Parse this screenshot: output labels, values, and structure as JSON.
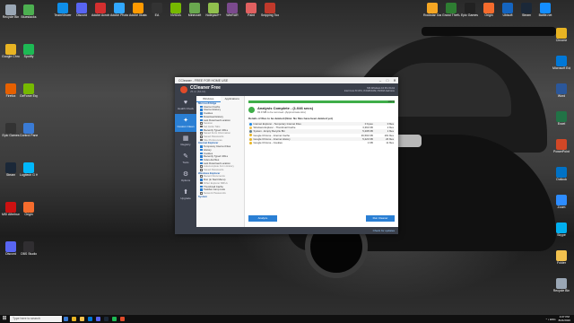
{
  "colors": {
    "accent": "#2a7fd4",
    "success": "#3fae49",
    "app_dark": "#3a3f4a"
  },
  "desktop": {
    "left_icons": [
      {
        "label": "Recycle Bin",
        "color": "#9aa7b5",
        "icon": "recycle-icon"
      },
      {
        "label": "Google Chrome",
        "color": "#e8b423",
        "icon": "chrome-icon"
      },
      {
        "label": "Firefox",
        "color": "#e66000",
        "icon": "firefox-icon"
      },
      {
        "label": "Epic Games",
        "color": "#333",
        "icon": "epic-icon"
      },
      {
        "label": "Steam",
        "color": "#1b2838",
        "icon": "steam-icon"
      },
      {
        "label": "MSI Afterburner",
        "color": "#c11",
        "icon": "afterburner-icon"
      },
      {
        "label": "Discord",
        "color": "#5865f2",
        "icon": "discord-icon"
      },
      {
        "label": "Bluestacks",
        "color": "#4caf50",
        "icon": "bluestacks-icon"
      },
      {
        "label": "Spotify",
        "color": "#1db954",
        "icon": "spotify-icon"
      },
      {
        "label": "GeForce Experience",
        "color": "#76b900",
        "icon": "geforce-icon"
      },
      {
        "label": "Control Panel",
        "color": "#3a7bd5",
        "icon": "control-panel-icon"
      },
      {
        "label": "Logitech G HUB",
        "color": "#00b8fc",
        "icon": "ghub-icon"
      },
      {
        "label": "Origin",
        "color": "#f56c2d",
        "icon": "origin-icon"
      },
      {
        "label": "OBS Studio",
        "color": "#302e31",
        "icon": "obs-icon"
      }
    ],
    "top_icons": [
      {
        "label": "TeamViewer",
        "color": "#0e8ee9",
        "icon": "teamviewer-icon"
      },
      {
        "label": "Discord",
        "color": "#5865f2",
        "icon": "discord-icon"
      },
      {
        "label": "Adobe Acrobat",
        "color": "#d32f2f",
        "icon": "acrobat-icon"
      },
      {
        "label": "Adobe Photoshop",
        "color": "#31a8ff",
        "icon": "photoshop-icon"
      },
      {
        "label": "Adobe Illustrator",
        "color": "#ff9a00",
        "icon": "illustrator-icon"
      },
      {
        "label": "EA",
        "color": "#333",
        "icon": "ea-icon"
      },
      {
        "label": "NVIDIA",
        "color": "#76b900",
        "icon": "nvidia-icon"
      },
      {
        "label": "Minecraft",
        "color": "#6aa84f",
        "icon": "minecraft-icon"
      },
      {
        "label": "Notepad++",
        "color": "#90c04d",
        "icon": "notepad-icon"
      },
      {
        "label": "WinRAR",
        "color": "#7b4a8d",
        "icon": "winrar-icon"
      },
      {
        "label": "Paint",
        "color": "#e06060",
        "icon": "paint-icon"
      },
      {
        "label": "Snipping Tool",
        "color": "#c0392b",
        "icon": "snip-icon"
      }
    ],
    "top_right_icons": [
      {
        "label": "Rockstar Games",
        "color": "#f5a623",
        "icon": "rockstar-icon"
      },
      {
        "label": "Grand Theft Auto V",
        "color": "#2e7d32",
        "icon": "gta-icon"
      },
      {
        "label": "Epic Games Launcher",
        "color": "#222",
        "icon": "epic-icon"
      },
      {
        "label": "Origin",
        "color": "#f56c2d",
        "icon": "origin-icon"
      },
      {
        "label": "Ubisoft",
        "color": "#1565c0",
        "icon": "ubisoft-icon"
      },
      {
        "label": "Steam",
        "color": "#1b2838",
        "icon": "steam-icon"
      },
      {
        "label": "Battle.net",
        "color": "#148eff",
        "icon": "battlenet-icon"
      }
    ],
    "right_icons": [
      {
        "label": "Chrome",
        "color": "#e8b423",
        "icon": "chrome-icon"
      },
      {
        "label": "Microsoft Edge",
        "color": "#0078d7",
        "icon": "edge-icon"
      },
      {
        "label": "Word",
        "color": "#2b579a",
        "icon": "word-icon"
      },
      {
        "label": "Excel",
        "color": "#217346",
        "icon": "excel-icon"
      },
      {
        "label": "PowerPoint",
        "color": "#d24726",
        "icon": "powerpoint-icon"
      },
      {
        "label": "Outlook",
        "color": "#0072c6",
        "icon": "outlook-icon"
      },
      {
        "label": "Zoom",
        "color": "#2d8cff",
        "icon": "zoom-icon"
      },
      {
        "label": "Skype",
        "color": "#00aff0",
        "icon": "skype-icon"
      },
      {
        "label": "Folder",
        "color": "#f2c14e",
        "icon": "folder-icon"
      },
      {
        "label": "Recycle Bin",
        "color": "#9aa7b5",
        "icon": "recycle-icon"
      }
    ]
  },
  "app": {
    "window_title": "CCleaner - FREE FOR HOME USE",
    "name": "CCleaner Free",
    "version": "v5.xx (64-bit)",
    "system_info": "MS Windows 10 Pro 64-bit",
    "system_info2": "Intel Core i5 CPU, 8.0GB RAM, NVIDIA GeForce",
    "nav": [
      {
        "label": "Health Check",
        "glyph": "♥",
        "icon": "heart-icon",
        "active": false
      },
      {
        "label": "Custom Clean",
        "glyph": "✦",
        "icon": "broom-icon",
        "active": true
      },
      {
        "label": "Registry",
        "glyph": "▦",
        "icon": "registry-icon",
        "active": false
      },
      {
        "label": "Tools",
        "glyph": "✎",
        "icon": "tools-icon",
        "active": false
      },
      {
        "label": "Options",
        "glyph": "⚙",
        "icon": "gear-icon",
        "active": false
      },
      {
        "label": "Upgrade",
        "glyph": "⬆",
        "icon": "upgrade-icon",
        "active": false
      }
    ],
    "tree_tabs": [
      "Windows",
      "Applications"
    ],
    "tree": [
      {
        "label": "Microsoft Edge",
        "type": "sec"
      },
      {
        "label": "Internet Cache",
        "type": "on"
      },
      {
        "label": "Internet History",
        "type": "on"
      },
      {
        "label": "Cookies",
        "type": "on"
      },
      {
        "label": "Download History",
        "type": "on"
      },
      {
        "label": "Last Download Location",
        "type": "on"
      },
      {
        "label": "Session",
        "type": "off"
      },
      {
        "label": "Set Aside Tabs",
        "type": "off"
      },
      {
        "label": "Recently Typed URLs",
        "type": "on"
      },
      {
        "label": "Saved Form Information",
        "type": "off"
      },
      {
        "label": "Saved Passwords",
        "type": "off"
      },
      {
        "label": "Site Preferences",
        "type": "off"
      },
      {
        "label": "Internet Explorer",
        "type": "sec"
      },
      {
        "label": "Temporary Internet Files",
        "type": "on"
      },
      {
        "label": "History",
        "type": "on"
      },
      {
        "label": "Cookies",
        "type": "on"
      },
      {
        "label": "Recently Typed URLs",
        "type": "on"
      },
      {
        "label": "Index.dat files",
        "type": "on"
      },
      {
        "label": "Last Download Location",
        "type": "on"
      },
      {
        "label": "Autocomplete Form History",
        "type": "off"
      },
      {
        "label": "Saved Passwords",
        "type": "off"
      },
      {
        "label": "Windows Explorer",
        "type": "sec"
      },
      {
        "label": "Recent Documents",
        "type": "off"
      },
      {
        "label": "Run (in Start Menu)",
        "type": "on"
      },
      {
        "label": "Other Explorer MRUs",
        "type": "off"
      },
      {
        "label": "Thumbnail Cache",
        "type": "on"
      },
      {
        "label": "Taskbar Jump Lists",
        "type": "on"
      },
      {
        "label": "Network Passwords",
        "type": "off"
      },
      {
        "label": "System",
        "type": "sec"
      }
    ],
    "progress": {
      "value": 1.0,
      "label": "100%"
    },
    "summary_title": "Analysis Complete - (1.046 secs)",
    "summary_sub": "93.9 MB to be removed. (Approximate size)",
    "details_title": "Details of files to be deleted (Note: No files have been deleted yet)",
    "rows": [
      {
        "name": "Internet Explorer - Temporary Internet Files",
        "size": "0 bytes",
        "files": "0 files",
        "color": "#1e88e5"
      },
      {
        "name": "Windows Explorer - Thumbnail Cache",
        "size": "3,363 KB",
        "files": "2 files",
        "color": "#f2c14e"
      },
      {
        "name": "System - Empty Recycle Bin",
        "size": "5,208 KB",
        "files": "1 files",
        "color": "#607d8b"
      },
      {
        "name": "Google Chrome - Internet Cache",
        "size": "46,593 KB",
        "files": "181 files",
        "color": "#e8b423"
      },
      {
        "name": "Google Chrome - Internet History",
        "size": "5,223 KB",
        "files": "26 files",
        "color": "#e8b423"
      },
      {
        "name": "Google Chrome - Cookies",
        "size": "1 KB",
        "files": "11 files",
        "color": "#e8b423"
      }
    ],
    "analyze_label": "Analyze",
    "run_label": "Run Cleaner",
    "update_label": "Check for updates"
  },
  "taskbar": {
    "start_label": "⊞",
    "search_placeholder": "Type here to search",
    "apps": [
      {
        "color": "#3a7bd5",
        "icon": "task-view-icon"
      },
      {
        "color": "#e8b423",
        "icon": "chrome-icon"
      },
      {
        "color": "#f2c14e",
        "icon": "explorer-icon"
      },
      {
        "color": "#0078d7",
        "icon": "edge-icon"
      },
      {
        "color": "#5865f2",
        "icon": "discord-icon"
      },
      {
        "color": "#1b2838",
        "icon": "steam-icon"
      },
      {
        "color": "#1db954",
        "icon": "spotify-icon"
      },
      {
        "color": "#e04b2a",
        "icon": "ccleaner-icon"
      }
    ],
    "tray_text": "^ ♪ ENG",
    "time": "4:07 PM",
    "date": "8/24/2020"
  }
}
